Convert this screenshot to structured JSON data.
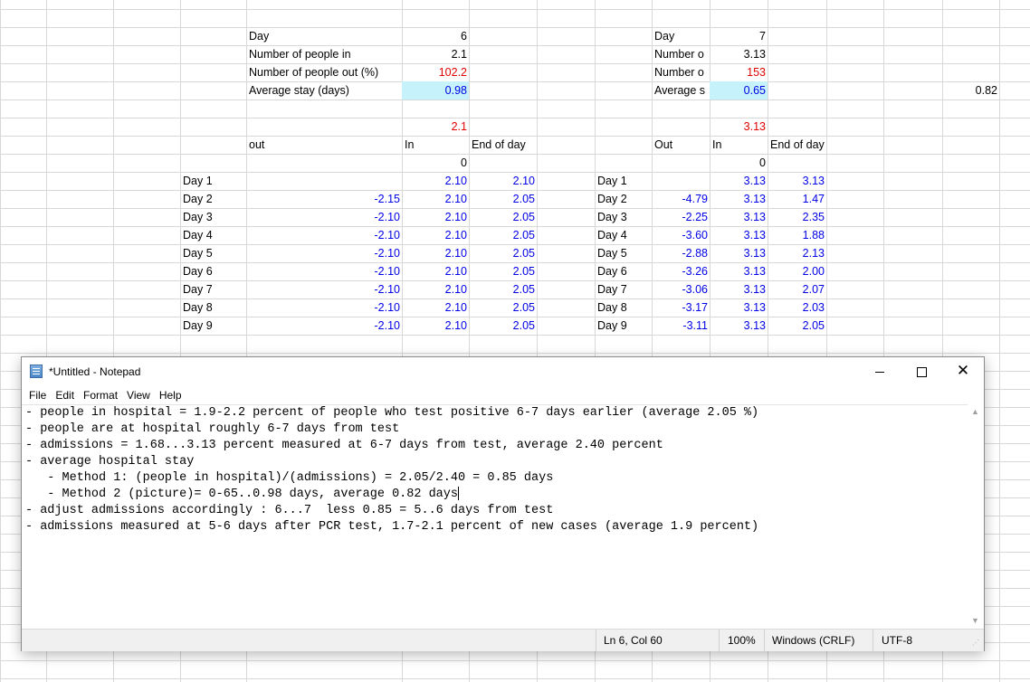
{
  "sheet": {
    "left": {
      "day_label": "Day",
      "day_value": "6",
      "people_in_label": "Number of people in",
      "people_in_value": "2.1",
      "people_out_label": "Number of people out (%)",
      "people_out_value": "102.2",
      "avg_stay_label": "Average stay (days)",
      "avg_stay_value": "0.98",
      "in_top": "2.1",
      "header_out": "out",
      "header_in": "In",
      "header_end": "End of day",
      "start_value": "0",
      "rows": [
        {
          "day": "Day 1",
          "out": "",
          "in": "2.10",
          "end": "2.10"
        },
        {
          "day": "Day 2",
          "out": "-2.15",
          "in": "2.10",
          "end": "2.05"
        },
        {
          "day": "Day 3",
          "out": "-2.10",
          "in": "2.10",
          "end": "2.05"
        },
        {
          "day": "Day 4",
          "out": "-2.10",
          "in": "2.10",
          "end": "2.05"
        },
        {
          "day": "Day 5",
          "out": "-2.10",
          "in": "2.10",
          "end": "2.05"
        },
        {
          "day": "Day 6",
          "out": "-2.10",
          "in": "2.10",
          "end": "2.05"
        },
        {
          "day": "Day 7",
          "out": "-2.10",
          "in": "2.10",
          "end": "2.05"
        },
        {
          "day": "Day 8",
          "out": "-2.10",
          "in": "2.10",
          "end": "2.05"
        },
        {
          "day": "Day 9",
          "out": "-2.10",
          "in": "2.10",
          "end": "2.05"
        }
      ]
    },
    "right": {
      "day_label": "Day",
      "day_value": "7",
      "people_in_label": "Number o",
      "people_in_value": "3.13",
      "people_out_label": "Number o",
      "people_out_value": "153",
      "avg_stay_label": "Average s",
      "avg_stay_value": "0.65",
      "in_top": "3.13",
      "header_out": "Out",
      "header_in": "In",
      "header_end": "End of day",
      "start_value": "0",
      "rows": [
        {
          "day": "Day 1",
          "out": "",
          "in": "3.13",
          "end": "3.13"
        },
        {
          "day": "Day 2",
          "out": "-4.79",
          "in": "3.13",
          "end": "1.47"
        },
        {
          "day": "Day 3",
          "out": "-2.25",
          "in": "3.13",
          "end": "2.35"
        },
        {
          "day": "Day 4",
          "out": "-3.60",
          "in": "3.13",
          "end": "1.88"
        },
        {
          "day": "Day 5",
          "out": "-2.88",
          "in": "3.13",
          "end": "2.13"
        },
        {
          "day": "Day 6",
          "out": "-3.26",
          "in": "3.13",
          "end": "2.00"
        },
        {
          "day": "Day 7",
          "out": "-3.06",
          "in": "3.13",
          "end": "2.07"
        },
        {
          "day": "Day 8",
          "out": "-3.17",
          "in": "3.13",
          "end": "2.03"
        },
        {
          "day": "Day 9",
          "out": "-3.11",
          "in": "3.13",
          "end": "2.05"
        }
      ]
    },
    "far_right_value": "0.82",
    "colors": {
      "highlight": "#c6f3fb",
      "blue_text": "#0000e6",
      "red_text": "#e00000",
      "gridline": "#d8d8d8"
    }
  },
  "notepad": {
    "title": "*Untitled - Notepad",
    "icon": "notepad-icon",
    "menu": [
      "File",
      "Edit",
      "Format",
      "View",
      "Help"
    ],
    "lines": [
      "- people in hospital = 1.9-2.2 percent of people who test positive 6-7 days earlier (average 2.05 %)",
      "- people are at hospital roughly 6-7 days from test",
      "- admissions = 1.68...3.13 percent measured at 6-7 days from test, average 2.40 percent",
      "- average hospital stay",
      "   - Method 1: (people in hospital)/(admissions) = 2.05/2.40 = 0.85 days",
      "   - Method 2 (picture)= 0-65..0.98 days, average 0.82 days",
      "- adjust admissions accordingly : 6...7  less 0.85 = 5..6 days from test",
      "- admissions measured at 5-6 days after PCR test, 1.7-2.1 percent of new cases (average 1.9 percent)"
    ],
    "status": {
      "position": "Ln 6, Col 60",
      "zoom": "100%",
      "line_ending": "Windows (CRLF)",
      "encoding": "UTF-8"
    }
  }
}
